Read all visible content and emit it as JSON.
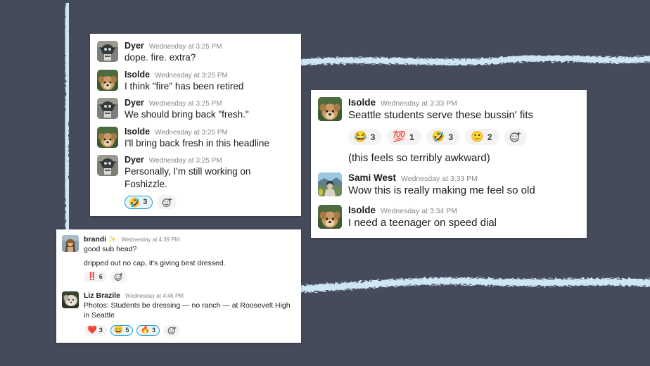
{
  "canvas": {
    "background_color": "#454b5a",
    "brush_color": "#cfe7f5"
  },
  "cards": [
    {
      "id": "convo-1",
      "messages": [
        {
          "author": "Dyer",
          "avatar": "beetle-photo",
          "timestamp": "Wednesday at 3:25 PM",
          "text": "dope. fire. extra?"
        },
        {
          "author": "Isolde",
          "avatar": "dog-photo",
          "timestamp": "Wednesday at 3:25 PM",
          "text": "I think \"fire\" has been retired"
        },
        {
          "author": "Dyer",
          "avatar": "beetle-photo",
          "timestamp": "Wednesday at 3:25 PM",
          "text": "We should bring back \"fresh.\""
        },
        {
          "author": "Isolde",
          "avatar": "dog-photo",
          "timestamp": "Wednesday at 3:25 PM",
          "text": "I'll bring back fresh in this headline"
        },
        {
          "author": "Dyer",
          "avatar": "beetle-photo",
          "timestamp": "Wednesday at 3:25 PM",
          "text": "Personally, I'm still working on Foshizzle.",
          "reactions": [
            {
              "emoji": "🤣",
              "name": "rolling-on-the-floor-laughing",
              "count": "3",
              "selected": true
            }
          ],
          "add_reaction_label": "add-reaction"
        }
      ]
    },
    {
      "id": "convo-2",
      "messages": [
        {
          "author": "Isolde",
          "avatar": "dog-photo",
          "timestamp": "Wednesday at 3:33 PM",
          "text": "Seattle students serve these bussin' fits",
          "reactions": [
            {
              "emoji": "😂",
              "name": "joy",
              "count": "3",
              "selected": false
            },
            {
              "emoji": "💯",
              "name": "hundred",
              "count": "1",
              "selected": false
            },
            {
              "emoji": "🤣",
              "name": "rofl",
              "count": "3",
              "selected": false
            },
            {
              "emoji": "🙂",
              "name": "slight-smile",
              "count": "2",
              "selected": false
            }
          ],
          "add_reaction_label": "add-reaction",
          "followup": "(this feels so terribly awkward)"
        },
        {
          "author": "Sami West",
          "avatar": "person-outdoors-photo",
          "timestamp": "Wednesday at 3:33 PM",
          "text": "Wow this is really making me feel so old"
        },
        {
          "author": "Isolde",
          "avatar": "dog-photo",
          "timestamp": "Wednesday at 3:34 PM",
          "text": "I need a teenager on speed dial"
        }
      ]
    },
    {
      "id": "convo-3",
      "messages": [
        {
          "author": "brandi",
          "badge": "✨",
          "avatar": "woman-photo",
          "timestamp": "Wednesday at 4:39 PM",
          "text": "good sub head?",
          "followup": "dripped out no cap, it's giving best dressed.",
          "reactions": [
            {
              "emoji": "‼️",
              "name": "double-exclamation",
              "count": "6",
              "selected": false
            }
          ],
          "add_reaction_label": "add-reaction"
        },
        {
          "author": "Liz Brazile",
          "avatar": "dog-light-photo",
          "timestamp": "Wednesday at 4:46 PM",
          "text": "Photos: Students be dressing — no ranch — at Roosevelt High in Seattle",
          "reactions": [
            {
              "emoji": "❤️",
              "name": "heart",
              "count": "3",
              "selected": false
            },
            {
              "emoji": "😄",
              "name": "smile",
              "count": "5",
              "selected": true
            },
            {
              "emoji": "🔥",
              "name": "fire",
              "count": "3",
              "selected": true
            }
          ],
          "add_reaction_label": "add-reaction"
        }
      ]
    }
  ]
}
